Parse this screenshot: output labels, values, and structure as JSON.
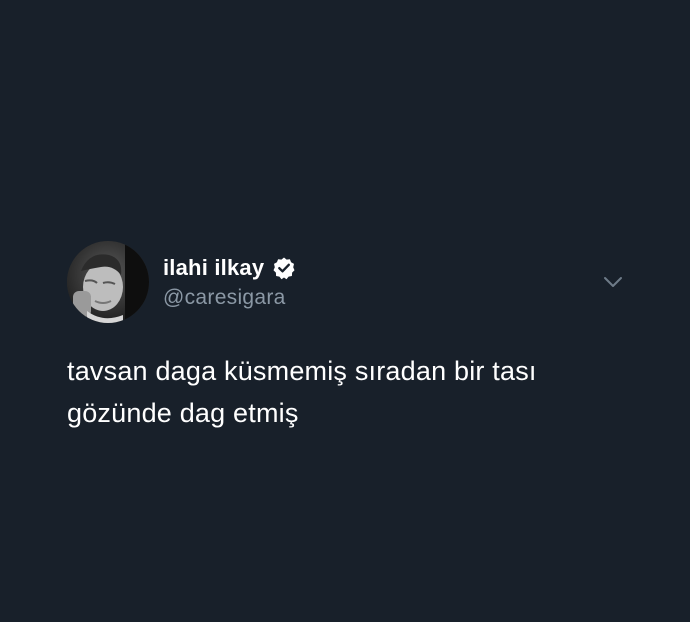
{
  "tweet": {
    "author": {
      "display_name": "ilahi ilkay",
      "handle": "@caresigara",
      "verified": true
    },
    "text_lines": [
      "tavsan daga küsmemiş sıradan bir tası",
      "gözünde dag etmiş"
    ],
    "icons": {
      "verified": "verified-badge-icon",
      "menu": "chevron-down-icon"
    }
  },
  "colors": {
    "background": "#18202a",
    "text_primary": "#ffffff",
    "text_secondary": "#8b98a5"
  }
}
